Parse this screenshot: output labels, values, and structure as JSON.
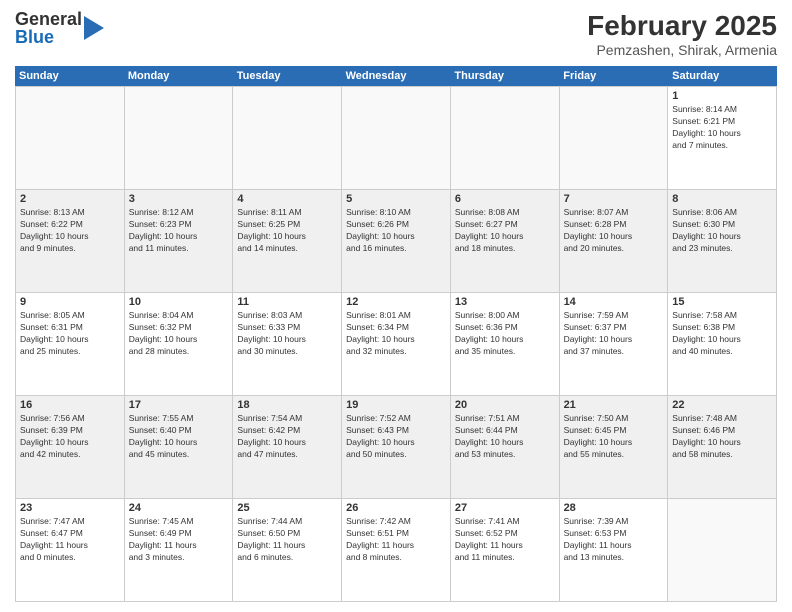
{
  "header": {
    "logo_general": "General",
    "logo_blue": "Blue",
    "title": "February 2025",
    "subtitle": "Pemzashen, Shirak, Armenia"
  },
  "calendar": {
    "days_of_week": [
      "Sunday",
      "Monday",
      "Tuesday",
      "Wednesday",
      "Thursday",
      "Friday",
      "Saturday"
    ],
    "weeks": [
      [
        {
          "day": "",
          "info": "",
          "empty": true
        },
        {
          "day": "",
          "info": "",
          "empty": true
        },
        {
          "day": "",
          "info": "",
          "empty": true
        },
        {
          "day": "",
          "info": "",
          "empty": true
        },
        {
          "day": "",
          "info": "",
          "empty": true
        },
        {
          "day": "",
          "info": "",
          "empty": true
        },
        {
          "day": "1",
          "info": "Sunrise: 8:14 AM\nSunset: 6:21 PM\nDaylight: 10 hours\nand 7 minutes."
        }
      ],
      [
        {
          "day": "2",
          "info": "Sunrise: 8:13 AM\nSunset: 6:22 PM\nDaylight: 10 hours\nand 9 minutes."
        },
        {
          "day": "3",
          "info": "Sunrise: 8:12 AM\nSunset: 6:23 PM\nDaylight: 10 hours\nand 11 minutes."
        },
        {
          "day": "4",
          "info": "Sunrise: 8:11 AM\nSunset: 6:25 PM\nDaylight: 10 hours\nand 14 minutes."
        },
        {
          "day": "5",
          "info": "Sunrise: 8:10 AM\nSunset: 6:26 PM\nDaylight: 10 hours\nand 16 minutes."
        },
        {
          "day": "6",
          "info": "Sunrise: 8:08 AM\nSunset: 6:27 PM\nDaylight: 10 hours\nand 18 minutes."
        },
        {
          "day": "7",
          "info": "Sunrise: 8:07 AM\nSunset: 6:28 PM\nDaylight: 10 hours\nand 20 minutes."
        },
        {
          "day": "8",
          "info": "Sunrise: 8:06 AM\nSunset: 6:30 PM\nDaylight: 10 hours\nand 23 minutes."
        }
      ],
      [
        {
          "day": "9",
          "info": "Sunrise: 8:05 AM\nSunset: 6:31 PM\nDaylight: 10 hours\nand 25 minutes."
        },
        {
          "day": "10",
          "info": "Sunrise: 8:04 AM\nSunset: 6:32 PM\nDaylight: 10 hours\nand 28 minutes."
        },
        {
          "day": "11",
          "info": "Sunrise: 8:03 AM\nSunset: 6:33 PM\nDaylight: 10 hours\nand 30 minutes."
        },
        {
          "day": "12",
          "info": "Sunrise: 8:01 AM\nSunset: 6:34 PM\nDaylight: 10 hours\nand 32 minutes."
        },
        {
          "day": "13",
          "info": "Sunrise: 8:00 AM\nSunset: 6:36 PM\nDaylight: 10 hours\nand 35 minutes."
        },
        {
          "day": "14",
          "info": "Sunrise: 7:59 AM\nSunset: 6:37 PM\nDaylight: 10 hours\nand 37 minutes."
        },
        {
          "day": "15",
          "info": "Sunrise: 7:58 AM\nSunset: 6:38 PM\nDaylight: 10 hours\nand 40 minutes."
        }
      ],
      [
        {
          "day": "16",
          "info": "Sunrise: 7:56 AM\nSunset: 6:39 PM\nDaylight: 10 hours\nand 42 minutes."
        },
        {
          "day": "17",
          "info": "Sunrise: 7:55 AM\nSunset: 6:40 PM\nDaylight: 10 hours\nand 45 minutes."
        },
        {
          "day": "18",
          "info": "Sunrise: 7:54 AM\nSunset: 6:42 PM\nDaylight: 10 hours\nand 47 minutes."
        },
        {
          "day": "19",
          "info": "Sunrise: 7:52 AM\nSunset: 6:43 PM\nDaylight: 10 hours\nand 50 minutes."
        },
        {
          "day": "20",
          "info": "Sunrise: 7:51 AM\nSunset: 6:44 PM\nDaylight: 10 hours\nand 53 minutes."
        },
        {
          "day": "21",
          "info": "Sunrise: 7:50 AM\nSunset: 6:45 PM\nDaylight: 10 hours\nand 55 minutes."
        },
        {
          "day": "22",
          "info": "Sunrise: 7:48 AM\nSunset: 6:46 PM\nDaylight: 10 hours\nand 58 minutes."
        }
      ],
      [
        {
          "day": "23",
          "info": "Sunrise: 7:47 AM\nSunset: 6:47 PM\nDaylight: 11 hours\nand 0 minutes."
        },
        {
          "day": "24",
          "info": "Sunrise: 7:45 AM\nSunset: 6:49 PM\nDaylight: 11 hours\nand 3 minutes."
        },
        {
          "day": "25",
          "info": "Sunrise: 7:44 AM\nSunset: 6:50 PM\nDaylight: 11 hours\nand 6 minutes."
        },
        {
          "day": "26",
          "info": "Sunrise: 7:42 AM\nSunset: 6:51 PM\nDaylight: 11 hours\nand 8 minutes."
        },
        {
          "day": "27",
          "info": "Sunrise: 7:41 AM\nSunset: 6:52 PM\nDaylight: 11 hours\nand 11 minutes."
        },
        {
          "day": "28",
          "info": "Sunrise: 7:39 AM\nSunset: 6:53 PM\nDaylight: 11 hours\nand 13 minutes."
        },
        {
          "day": "",
          "info": "",
          "empty": true
        }
      ]
    ]
  }
}
